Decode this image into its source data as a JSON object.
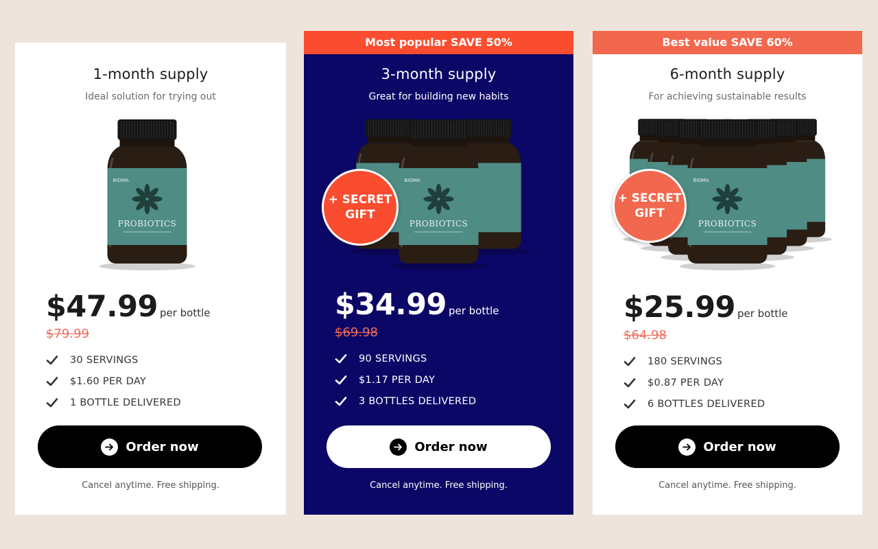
{
  "plans": [
    {
      "banner": "",
      "title": "1-month supply",
      "subtitle": "Ideal solution for trying out",
      "gift_label": "",
      "price": "$47.99",
      "per_unit": "per bottle",
      "old_price": "$79.99",
      "features": [
        "30 SERVINGS",
        "$1.60 PER DAY",
        "1 BOTTLE DELIVERED"
      ],
      "cta_label": "Order now",
      "footnote": "Cancel anytime. Free shipping.",
      "bottle_count": 1
    },
    {
      "banner": "Most popular SAVE 50%",
      "title": "3-month supply",
      "subtitle": "Great for building new habits",
      "gift_label": "+ SECRET GIFT",
      "price": "$34.99",
      "per_unit": "per bottle",
      "old_price": "$69.98",
      "features": [
        "90 SERVINGS",
        "$1.17 PER DAY",
        "3 BOTTLES DELIVERED"
      ],
      "cta_label": "Order now",
      "footnote": "Cancel anytime. Free shipping.",
      "bottle_count": 3
    },
    {
      "banner": "Best value SAVE 60%",
      "title": "6-month supply",
      "subtitle": "For achieving sustainable results",
      "gift_label": "+ SECRET GIFT",
      "price": "$25.99",
      "per_unit": "per bottle",
      "old_price": "$64.98",
      "features": [
        "180 SERVINGS",
        "$0.87 PER DAY",
        "6 BOTTLES DELIVERED"
      ],
      "cta_label": "Order now",
      "footnote": "Cancel anytime. Free shipping.",
      "bottle_count": 6
    }
  ],
  "product_label": {
    "brand": "BIOMA",
    "name": "PROBIOTICS"
  },
  "colors": {
    "background": "#efe4dc",
    "featured_card": "#0b0766",
    "banner_popular": "#fa4d2f",
    "banner_value": "#f2684e",
    "old_price": "#f06b5a",
    "label_teal": "#4e8c84"
  },
  "icons": {
    "feature": "checkmark-icon",
    "cta": "arrow-right-circle-icon"
  }
}
